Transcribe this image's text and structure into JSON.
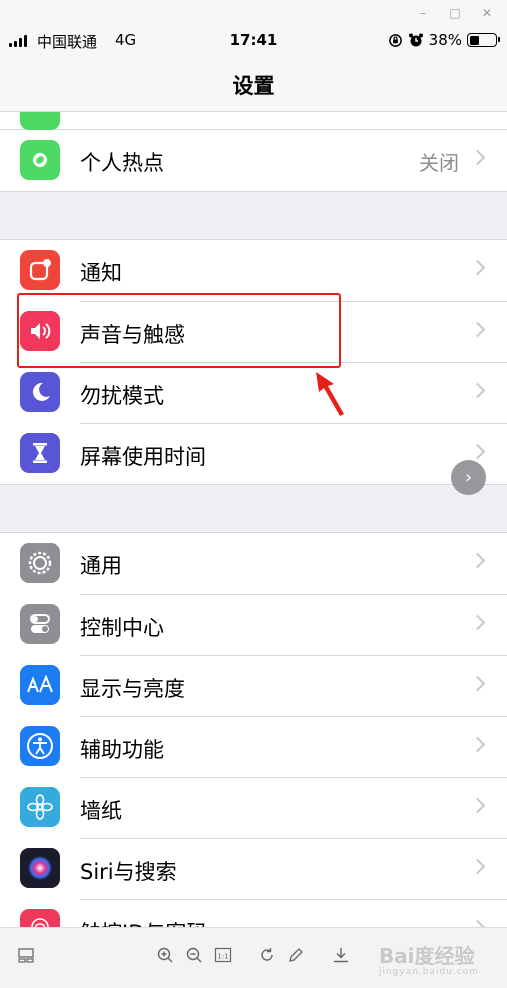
{
  "window": {
    "minimize": "–",
    "maximize": "□",
    "close": "✕"
  },
  "status_bar": {
    "carrier": "中国联通",
    "network": "4G",
    "time": "17:41",
    "battery": "38%",
    "battery_level": 0.38
  },
  "nav": {
    "title": "设置"
  },
  "groups": [
    {
      "rows": [
        {
          "label": "个人热点",
          "value": "关闭",
          "icon": "hotspot-icon",
          "color": "#4cd964"
        }
      ]
    },
    {
      "rows": [
        {
          "label": "通知",
          "value": "",
          "icon": "notifications-icon",
          "color": "#f0453a"
        },
        {
          "label": "声音与触感",
          "value": "",
          "icon": "speaker-icon",
          "color": "#f0385d"
        },
        {
          "label": "勿扰模式",
          "value": "",
          "icon": "moon-icon",
          "color": "#5856d6"
        },
        {
          "label": "屏幕使用时间",
          "value": "",
          "icon": "hourglass-icon",
          "color": "#5856d6"
        }
      ]
    },
    {
      "rows": [
        {
          "label": "通用",
          "value": "",
          "icon": "gear-icon",
          "color": "#8e8e93"
        },
        {
          "label": "控制中心",
          "value": "",
          "icon": "toggles-icon",
          "color": "#8e8e93"
        },
        {
          "label": "显示与亮度",
          "value": "",
          "icon": "text-size-icon",
          "color": "#1c7cf2"
        },
        {
          "label": "辅助功能",
          "value": "",
          "icon": "accessibility-icon",
          "color": "#1c7cf2"
        },
        {
          "label": "墙纸",
          "value": "",
          "icon": "flower-icon",
          "color": "#35aadc"
        },
        {
          "label": "Siri与搜索",
          "value": "",
          "icon": "siri-icon",
          "color": "#1b1b2e"
        },
        {
          "label": "触控ID与密码",
          "value": "",
          "icon": "fingerprint-icon",
          "color": "#f0385d"
        }
      ]
    }
  ],
  "toolbar": {
    "watermark": "Bai度经验",
    "watermark_sub": "jingyan.baidu.com"
  },
  "colors": {
    "annotation": "#e32119"
  }
}
